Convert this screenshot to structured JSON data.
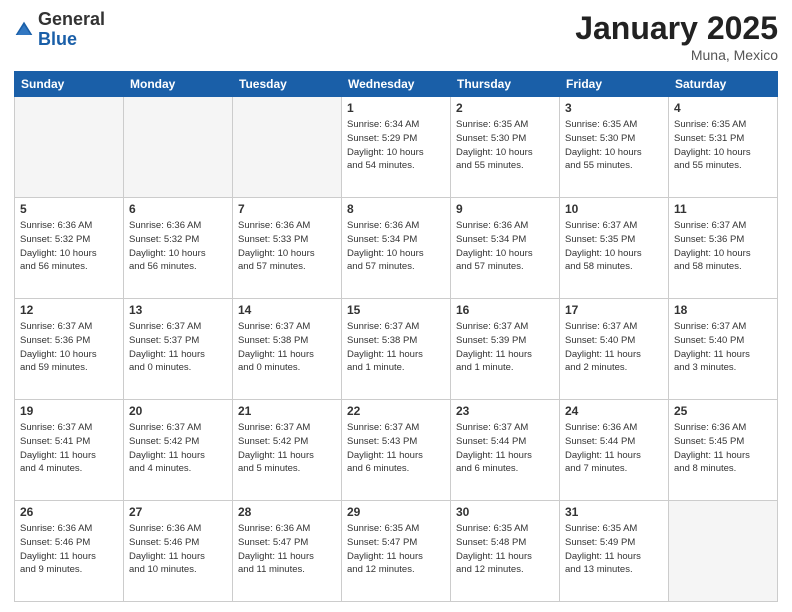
{
  "header": {
    "logo_general": "General",
    "logo_blue": "Blue",
    "month_title": "January 2025",
    "location": "Muna, Mexico"
  },
  "days_of_week": [
    "Sunday",
    "Monday",
    "Tuesday",
    "Wednesday",
    "Thursday",
    "Friday",
    "Saturday"
  ],
  "weeks": [
    [
      {
        "day": "",
        "info": "",
        "empty": true
      },
      {
        "day": "",
        "info": "",
        "empty": true
      },
      {
        "day": "",
        "info": "",
        "empty": true
      },
      {
        "day": "1",
        "info": "Sunrise: 6:34 AM\nSunset: 5:29 PM\nDaylight: 10 hours\nand 54 minutes."
      },
      {
        "day": "2",
        "info": "Sunrise: 6:35 AM\nSunset: 5:30 PM\nDaylight: 10 hours\nand 55 minutes."
      },
      {
        "day": "3",
        "info": "Sunrise: 6:35 AM\nSunset: 5:30 PM\nDaylight: 10 hours\nand 55 minutes."
      },
      {
        "day": "4",
        "info": "Sunrise: 6:35 AM\nSunset: 5:31 PM\nDaylight: 10 hours\nand 55 minutes."
      }
    ],
    [
      {
        "day": "5",
        "info": "Sunrise: 6:36 AM\nSunset: 5:32 PM\nDaylight: 10 hours\nand 56 minutes."
      },
      {
        "day": "6",
        "info": "Sunrise: 6:36 AM\nSunset: 5:32 PM\nDaylight: 10 hours\nand 56 minutes."
      },
      {
        "day": "7",
        "info": "Sunrise: 6:36 AM\nSunset: 5:33 PM\nDaylight: 10 hours\nand 57 minutes."
      },
      {
        "day": "8",
        "info": "Sunrise: 6:36 AM\nSunset: 5:34 PM\nDaylight: 10 hours\nand 57 minutes."
      },
      {
        "day": "9",
        "info": "Sunrise: 6:36 AM\nSunset: 5:34 PM\nDaylight: 10 hours\nand 57 minutes."
      },
      {
        "day": "10",
        "info": "Sunrise: 6:37 AM\nSunset: 5:35 PM\nDaylight: 10 hours\nand 58 minutes."
      },
      {
        "day": "11",
        "info": "Sunrise: 6:37 AM\nSunset: 5:36 PM\nDaylight: 10 hours\nand 58 minutes."
      }
    ],
    [
      {
        "day": "12",
        "info": "Sunrise: 6:37 AM\nSunset: 5:36 PM\nDaylight: 10 hours\nand 59 minutes."
      },
      {
        "day": "13",
        "info": "Sunrise: 6:37 AM\nSunset: 5:37 PM\nDaylight: 11 hours\nand 0 minutes."
      },
      {
        "day": "14",
        "info": "Sunrise: 6:37 AM\nSunset: 5:38 PM\nDaylight: 11 hours\nand 0 minutes."
      },
      {
        "day": "15",
        "info": "Sunrise: 6:37 AM\nSunset: 5:38 PM\nDaylight: 11 hours\nand 1 minute."
      },
      {
        "day": "16",
        "info": "Sunrise: 6:37 AM\nSunset: 5:39 PM\nDaylight: 11 hours\nand 1 minute."
      },
      {
        "day": "17",
        "info": "Sunrise: 6:37 AM\nSunset: 5:40 PM\nDaylight: 11 hours\nand 2 minutes."
      },
      {
        "day": "18",
        "info": "Sunrise: 6:37 AM\nSunset: 5:40 PM\nDaylight: 11 hours\nand 3 minutes."
      }
    ],
    [
      {
        "day": "19",
        "info": "Sunrise: 6:37 AM\nSunset: 5:41 PM\nDaylight: 11 hours\nand 4 minutes."
      },
      {
        "day": "20",
        "info": "Sunrise: 6:37 AM\nSunset: 5:42 PM\nDaylight: 11 hours\nand 4 minutes."
      },
      {
        "day": "21",
        "info": "Sunrise: 6:37 AM\nSunset: 5:42 PM\nDaylight: 11 hours\nand 5 minutes."
      },
      {
        "day": "22",
        "info": "Sunrise: 6:37 AM\nSunset: 5:43 PM\nDaylight: 11 hours\nand 6 minutes."
      },
      {
        "day": "23",
        "info": "Sunrise: 6:37 AM\nSunset: 5:44 PM\nDaylight: 11 hours\nand 6 minutes."
      },
      {
        "day": "24",
        "info": "Sunrise: 6:36 AM\nSunset: 5:44 PM\nDaylight: 11 hours\nand 7 minutes."
      },
      {
        "day": "25",
        "info": "Sunrise: 6:36 AM\nSunset: 5:45 PM\nDaylight: 11 hours\nand 8 minutes."
      }
    ],
    [
      {
        "day": "26",
        "info": "Sunrise: 6:36 AM\nSunset: 5:46 PM\nDaylight: 11 hours\nand 9 minutes."
      },
      {
        "day": "27",
        "info": "Sunrise: 6:36 AM\nSunset: 5:46 PM\nDaylight: 11 hours\nand 10 minutes."
      },
      {
        "day": "28",
        "info": "Sunrise: 6:36 AM\nSunset: 5:47 PM\nDaylight: 11 hours\nand 11 minutes."
      },
      {
        "day": "29",
        "info": "Sunrise: 6:35 AM\nSunset: 5:47 PM\nDaylight: 11 hours\nand 12 minutes."
      },
      {
        "day": "30",
        "info": "Sunrise: 6:35 AM\nSunset: 5:48 PM\nDaylight: 11 hours\nand 12 minutes."
      },
      {
        "day": "31",
        "info": "Sunrise: 6:35 AM\nSunset: 5:49 PM\nDaylight: 11 hours\nand 13 minutes."
      },
      {
        "day": "",
        "info": "",
        "empty": true
      }
    ]
  ]
}
